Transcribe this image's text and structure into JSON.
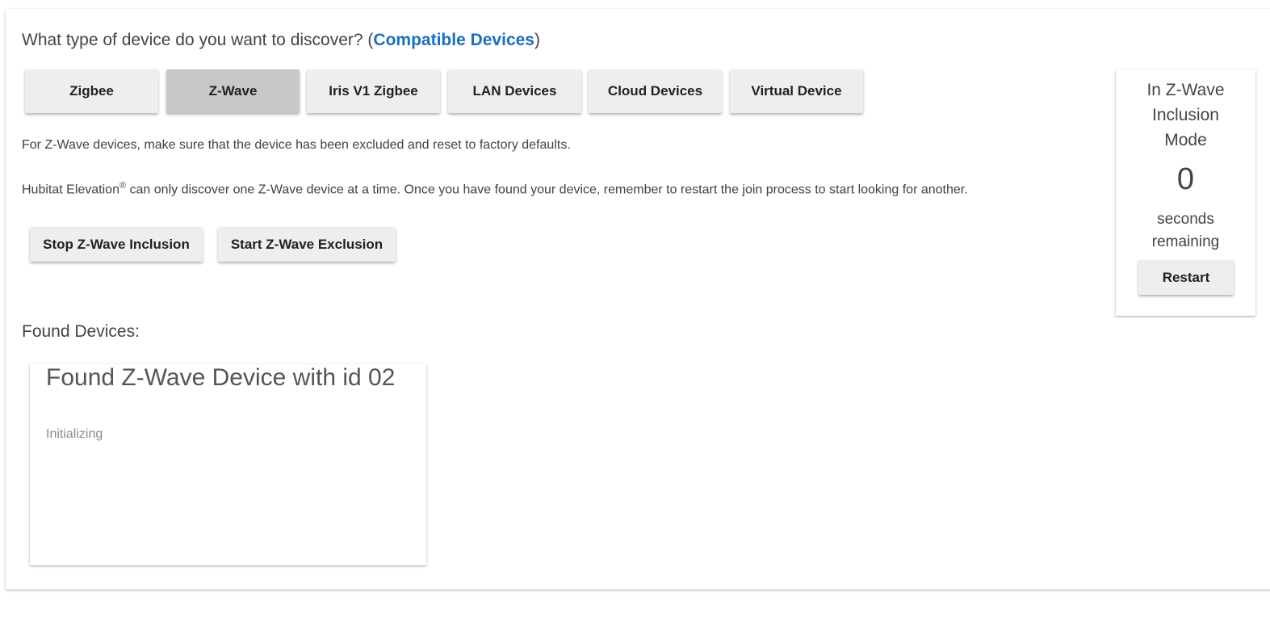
{
  "discover": {
    "question_prefix": "What type of device do you want to discover? (",
    "compatible_link": "Compatible Devices",
    "question_suffix": ")"
  },
  "device_types": [
    {
      "label": "Zigbee",
      "selected": false
    },
    {
      "label": "Z-Wave",
      "selected": true
    },
    {
      "label": "Iris V1 Zigbee",
      "selected": false
    },
    {
      "label": "LAN Devices",
      "selected": false
    },
    {
      "label": "Cloud Devices",
      "selected": false
    },
    {
      "label": "Virtual Device",
      "selected": false
    }
  ],
  "instructions": {
    "line1": "For Z-Wave devices, make sure that the device has been excluded and reset to factory defaults.",
    "line2_prefix": "Hubitat Elevation",
    "line2_mark": "®",
    "line2_suffix": " can only discover one Z-Wave device at a time. Once you have found your device, remember to restart the join process to start looking for another."
  },
  "actions": {
    "stop_inclusion": "Stop Z-Wave Inclusion",
    "start_exclusion": "Start Z-Wave Exclusion"
  },
  "found": {
    "label": "Found Devices:",
    "devices": [
      {
        "title": "Found Z-Wave Device with id 02",
        "status": "Initializing"
      }
    ]
  },
  "inclusion_panel": {
    "mode_line1": "In Z-Wave",
    "mode_line2": "Inclusion",
    "mode_line3": "Mode",
    "seconds": "0",
    "seconds_line1": "seconds",
    "seconds_line2": "remaining",
    "restart_label": "Restart"
  },
  "colors": {
    "link": "#1a6fc0",
    "button_bg": "#eeeeee",
    "button_active_bg": "#c8c8c8"
  }
}
